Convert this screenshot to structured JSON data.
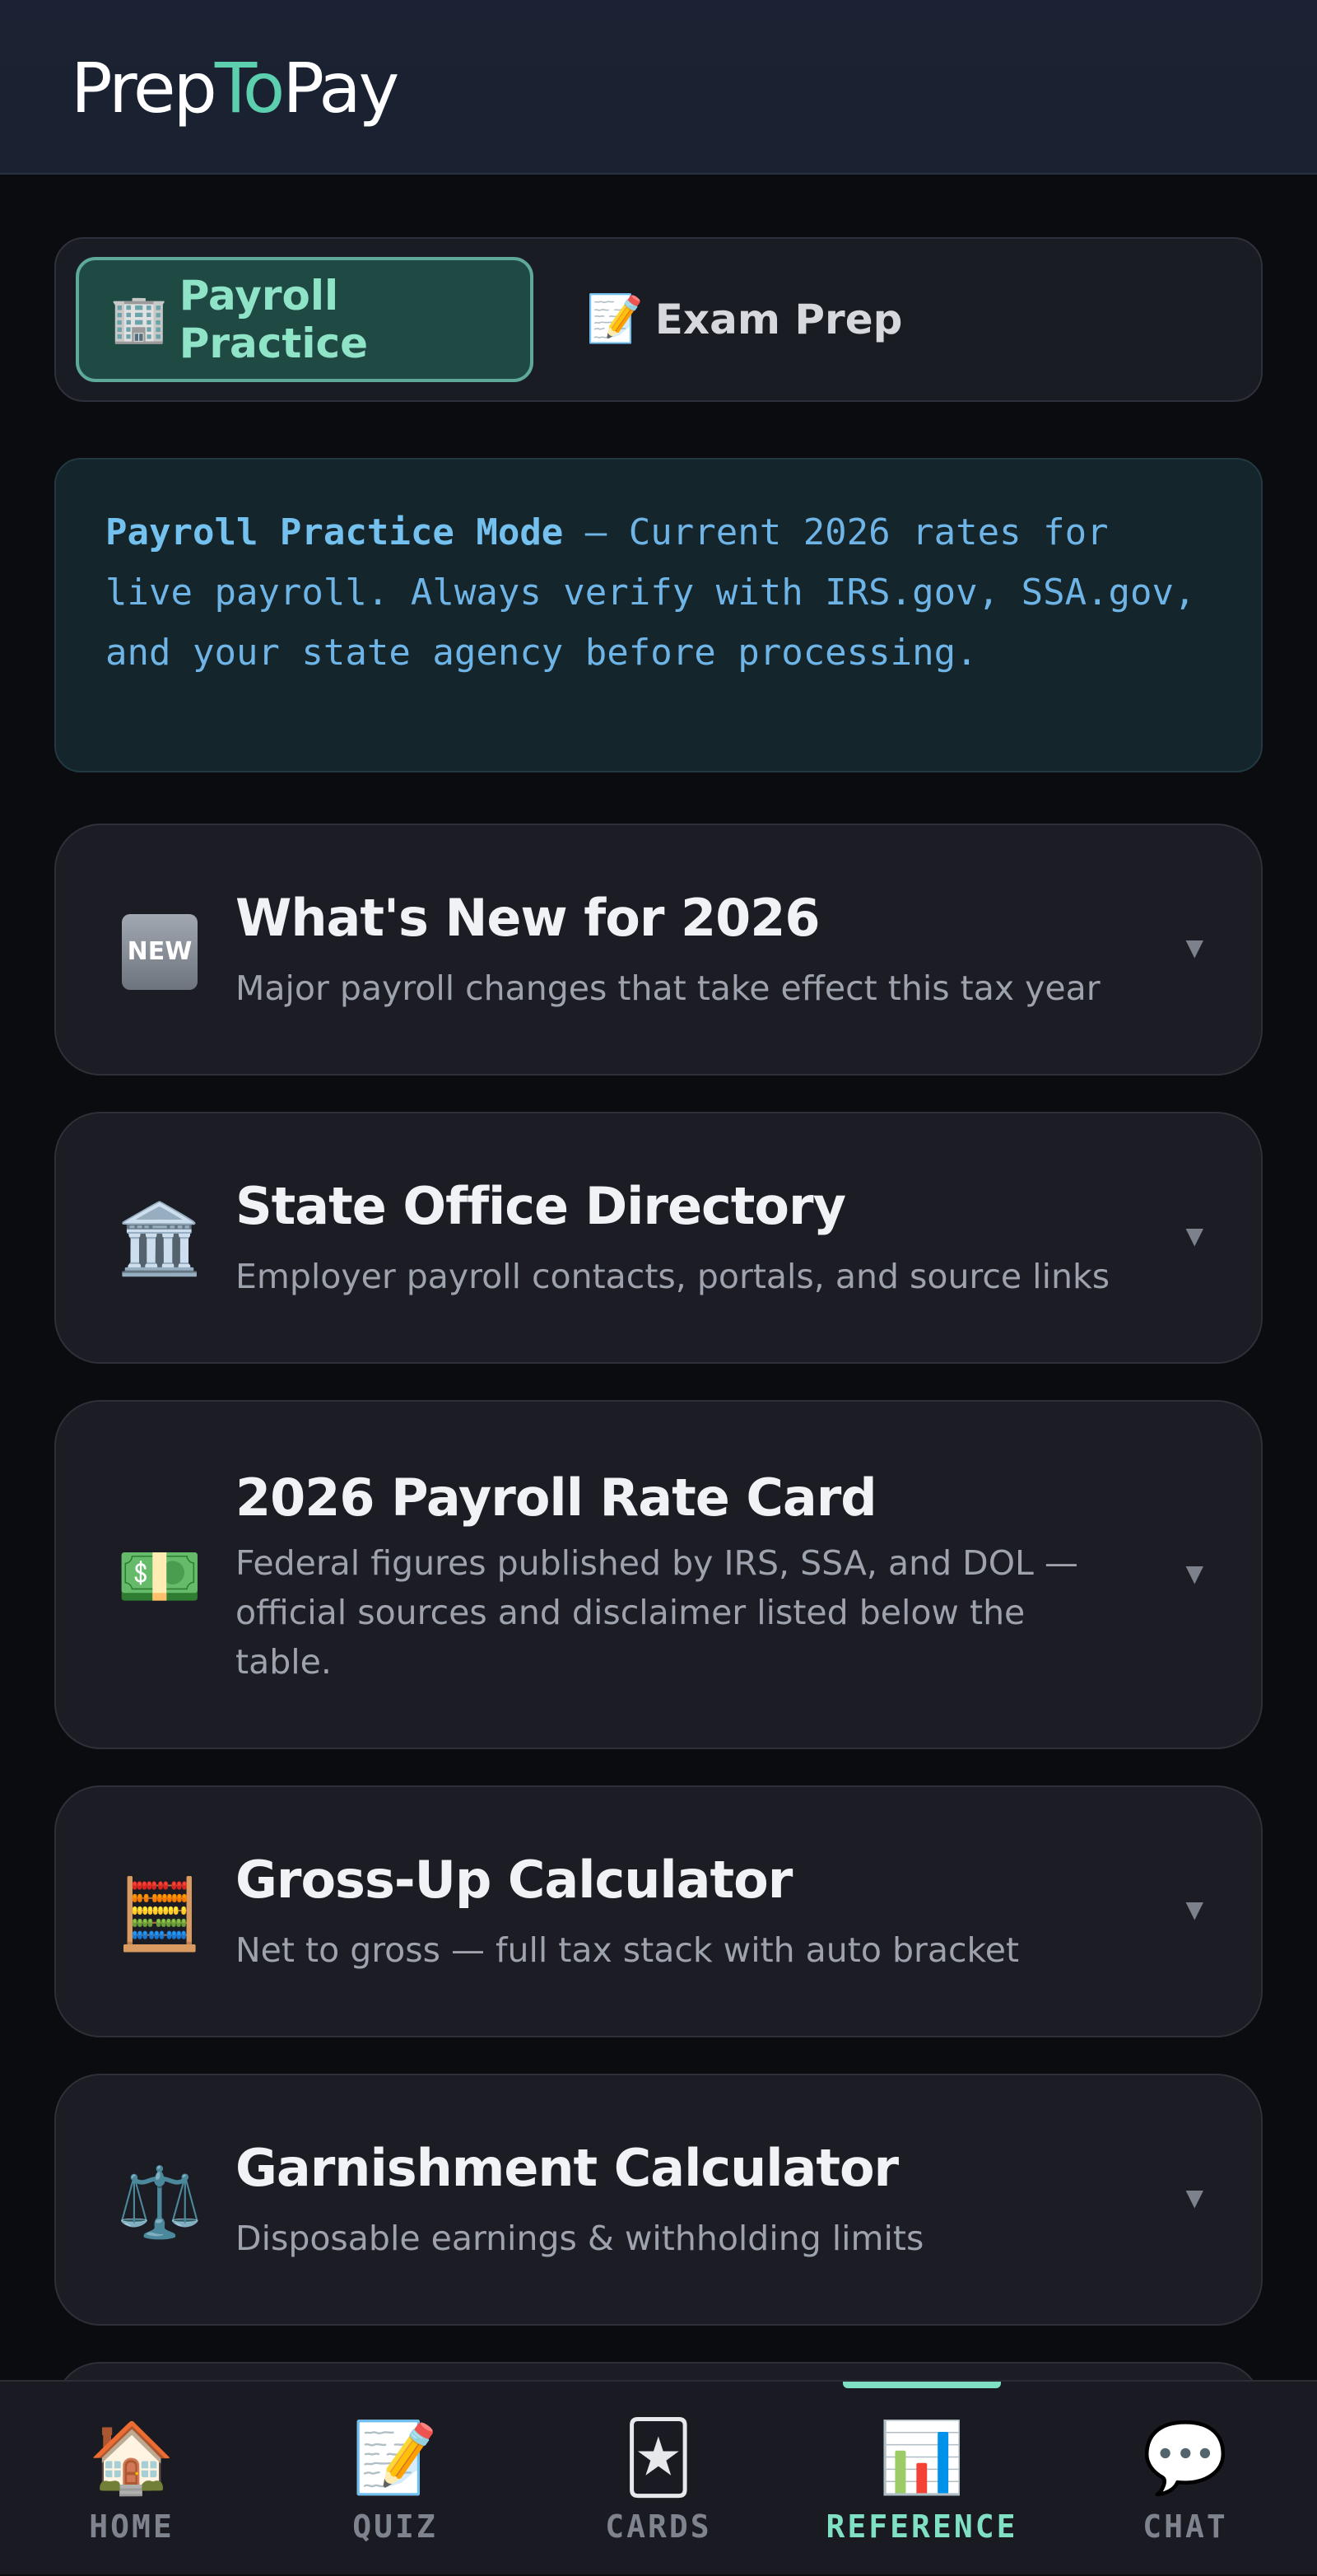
{
  "header": {
    "logo_part1": "Prep",
    "logo_part2": "To",
    "logo_part3": "Pay"
  },
  "mode_toggle": {
    "active": {
      "emoji": "🏢",
      "label": "Payroll Practice"
    },
    "inactive": {
      "emoji": "📝",
      "label": "Exam Prep"
    }
  },
  "info": {
    "strong": "Payroll Practice Mode",
    "text": " — Current 2026 rates for live payroll. Always verify with IRS.gov, SSA.gov, and your state agency before processing."
  },
  "cards": [
    {
      "icon": "🆕",
      "badge_text": "NEW",
      "title": "What's New for 2026",
      "subtitle": "Major payroll changes that take effect this tax year"
    },
    {
      "icon": "🏛️",
      "title": "State Office Directory",
      "subtitle": "Employer payroll contacts, portals, and source links"
    },
    {
      "icon": "💵",
      "title": "2026 Payroll Rate Card",
      "subtitle": "Federal figures published by IRS, SSA, and DOL — official sources and disclaimer listed below the table."
    },
    {
      "icon": "🧮",
      "title": "Gross-Up Calculator",
      "subtitle": "Net to gross — full tax stack with auto bracket"
    },
    {
      "icon": "⚖️",
      "title": "Garnishment Calculator",
      "subtitle": "Disposable earnings & withholding limits"
    }
  ],
  "chevron": "▼",
  "bottom_nav": [
    {
      "icon": "🏠",
      "label": "HOME"
    },
    {
      "icon": "📝",
      "label": "QUIZ"
    },
    {
      "icon": "🃏",
      "label": "CARDS"
    },
    {
      "icon": "📊",
      "label": "REFERENCE"
    },
    {
      "icon": "💬",
      "label": "CHAT"
    }
  ],
  "colors": {
    "accent": "#5ccfae",
    "background": "#0b0c0f",
    "card": "#1b1c24"
  }
}
